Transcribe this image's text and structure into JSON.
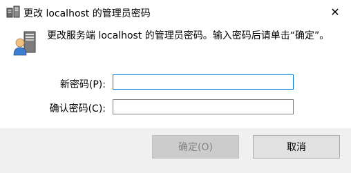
{
  "window": {
    "title": "更改 localhost 的管理员密码",
    "close_glyph": "✕"
  },
  "message": "更改服务端 localhost 的管理员密码。输入密码后请单击“确定”。",
  "fields": {
    "new_password_label": "新密码(P):",
    "confirm_password_label": "确认密码(C):",
    "new_password_value": "",
    "confirm_password_value": ""
  },
  "buttons": {
    "ok": "确定(O)",
    "cancel": "取消"
  }
}
